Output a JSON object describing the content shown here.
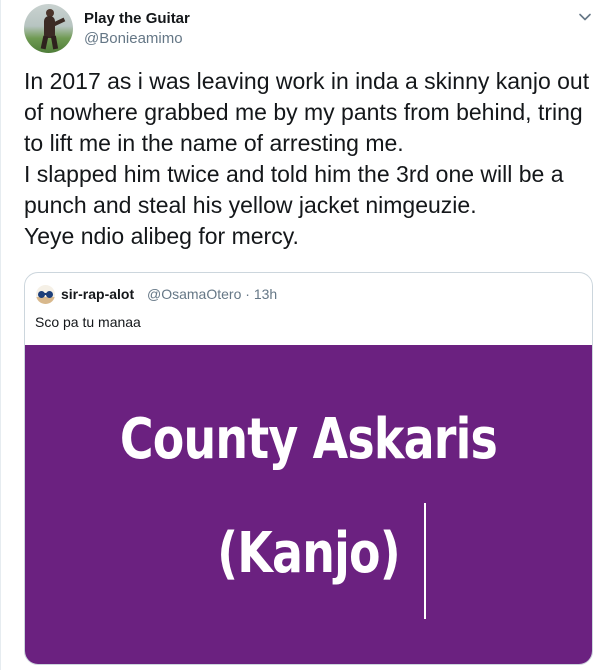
{
  "tweet": {
    "display_name": "Play the Guitar",
    "handle": "@Bonieamimo",
    "lines": [
      "In 2017 as i was leaving work in inda a skinny kanjo out",
      "of nowhere grabbed me by my pants from behind, tring",
      "to lift me in the name of arresting me.",
      "I slapped him twice and told him the 3rd one will be a",
      "punch and steal his yellow jacket nimgeuzie.",
      "Yeye ndio alibeg for mercy."
    ],
    "avatar_icon": "profile-photo-person-on-grass",
    "menu_icon": "chevron-down-icon"
  },
  "quote": {
    "display_name": "sir-rap-alot",
    "handle": "@OsamaOtero",
    "separator": "·",
    "time": "13h",
    "text": "Sco pa tu manaa",
    "avatar_icon": "profile-photo-sunglasses",
    "image": {
      "line1": "County Askaris",
      "line2": "(Kanjo)",
      "background": "#6b2180",
      "text_color": "#ffffff"
    }
  },
  "colors": {
    "text": "#14171a",
    "secondary": "#657786",
    "border": "#ccd6dd"
  }
}
